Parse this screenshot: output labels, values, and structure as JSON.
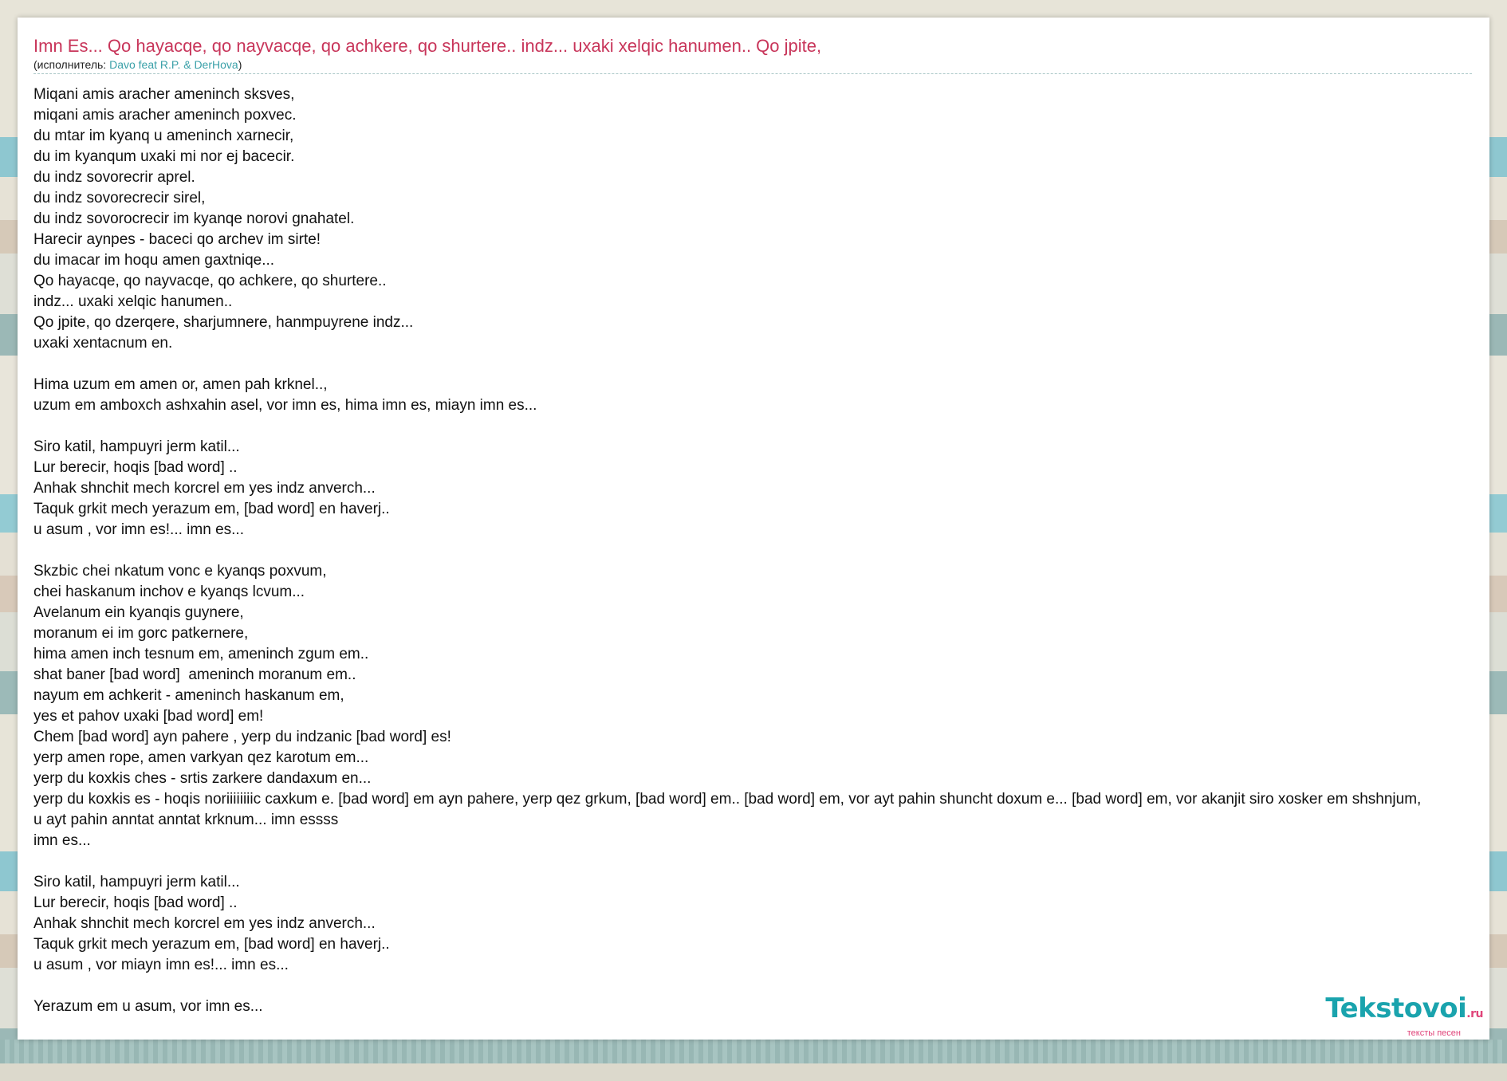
{
  "song": {
    "title": "Imn Es... Qo hayacqe, qo nayvacqe, qo achkere, qo shurtere.. indz... uxaki xelqic hanumen.. Qo jpite,",
    "artist_prefix": "(исполнитель: ",
    "artist": "Davo feat R.P. & DerHova",
    "artist_suffix": ")"
  },
  "lyrics": "Miqani amis aracher ameninch sksves,\nmiqani amis aracher ameninch poxvec.\ndu mtar im kyanq u ameninch xarnecir,\ndu im kyanqum uxaki mi nor ej bacecir.\ndu indz sovorecrir aprel.\ndu indz sovorecrecir sirel,\ndu indz sovorocrecir im kyanqe norovi gnahatel.\nHarecir aynpes - baceci qo archev im sirte!\ndu imacar im hoqu amen gaxtniqe...\nQo hayacqe, qo nayvacqe, qo achkere, qo shurtere..\nindz... uxaki xelqic hanumen..\nQo jpite, qo dzerqere, sharjumnere, hanmpuyrene indz...\nuxaki xentacnum en.\n\nHima uzum em amen or, amen pah krknel..,\nuzum em amboxch ashxahin asel, vor imn es, hima imn es, miayn imn es...\n\nSiro katil, hampuyri jerm katil...\nLur berecir, hoqis [bad word] ..\nAnhak shnchit mech korcrel em yes indz anverch...\nTaquk grkit mech yerazum em, [bad word] en haverj..\nu asum , vor imn es!... imn es...\n\nSkzbic chei nkatum vonc e kyanqs poxvum,\nchei haskanum inchov e kyanqs lcvum...\nAvelanum ein kyanqis guynere,\nmoranum ei im gorc patkernere,\nhima amen inch tesnum em, ameninch zgum em..\nshat baner [bad word]  ameninch moranum em..\nnayum em achkerit - ameninch haskanum em,\nyes et pahov uxaki [bad word] em!\nChem [bad word] ayn pahere , yerp du indzanic [bad word] es!\nyerp amen rope, amen varkyan qez karotum em...\nyerp du koxkis ches - srtis zarkere dandaxum en...\nyerp du koxkis es - hoqis noriiiiiiiic caxkum e. [bad word] em ayn pahere, yerp qez grkum, [bad word] em.. [bad word] em, vor ayt pahin shuncht doxum e... [bad word] em, vor akanjit siro xosker em shshnjum,\nu ayt pahin anntat anntat krknum... imn essss\nimn es...\n\nSiro katil, hampuyri jerm katil...\nLur berecir, hoqis [bad word] ..\nAnhak shnchit mech korcrel em yes indz anverch...\nTaquk grkit mech yerazum em, [bad word] en haverj..\nu asum , vor miayn imn es!... imn es...\n\nYerazum em u asum, vor imn es...",
  "logo": {
    "name": "Tekstovoi",
    "tld": ".ru",
    "tagline": "тексты песен"
  }
}
